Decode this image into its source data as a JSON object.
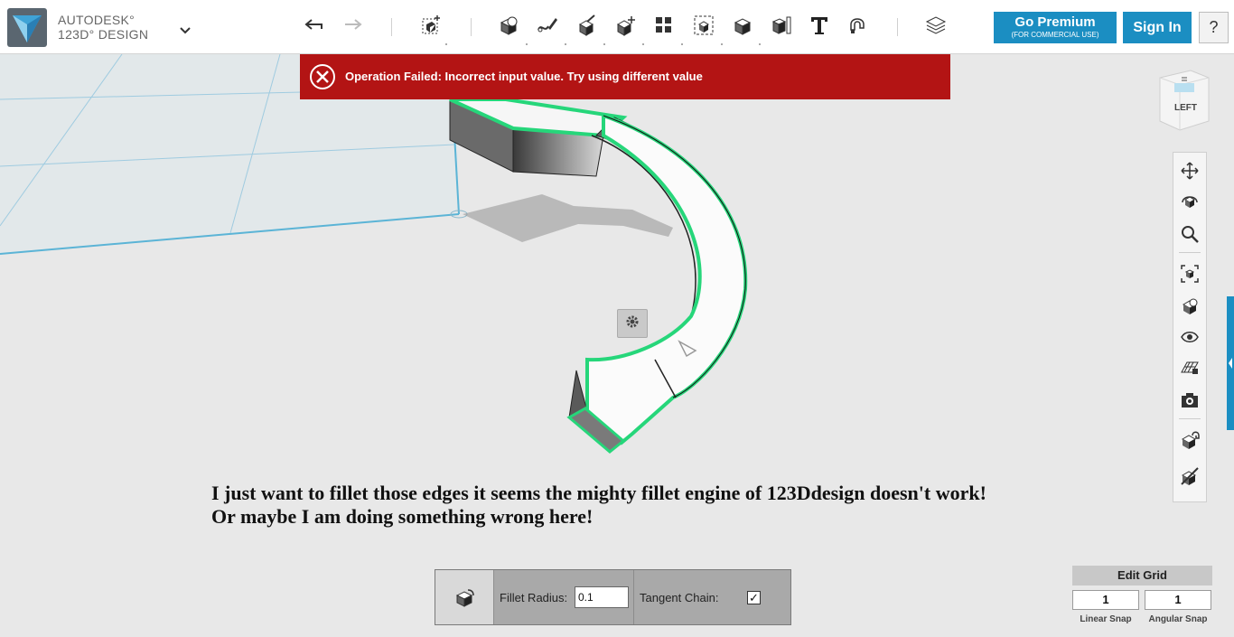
{
  "app": {
    "brand_line1": "AUTODESK°",
    "brand_line2": "123D° DESIGN",
    "accent_color": "#1b8ec2",
    "error_color": "#b31414"
  },
  "toolbar": {
    "icons": [
      "undo-icon",
      "redo-icon",
      "transform-icon",
      "primitives-icon",
      "sketch-icon",
      "construct-icon",
      "modify-icon",
      "pattern-icon",
      "grouping-icon",
      "combine-icon",
      "measure-icon",
      "text-icon",
      "snap-icon",
      "materials-icon"
    ],
    "premium_label": "Go Premium",
    "premium_sub": "(FOR COMMERCIAL USE)",
    "signin_label": "Sign In",
    "help_label": "?"
  },
  "error": {
    "message": "Operation Failed: Incorrect input value. Try using different value"
  },
  "viewcube": {
    "face_label": "LEFT"
  },
  "navbar": {
    "icons": [
      "pan-icon",
      "orbit-icon",
      "zoom-icon",
      "fit-icon",
      "view-mode-icon",
      "visibility-icon",
      "grid-icon",
      "camera-icon",
      "snap-tool-icon",
      "hide-icon"
    ]
  },
  "note": {
    "line1": "I just want to fillet those edges it seems the mighty fillet engine of 123Ddesign doesn't work!",
    "line2": "Or maybe I am doing something wrong here!"
  },
  "fillet": {
    "radius_label": "Fillet Radius:",
    "radius_value": "0.1",
    "tangent_label": "Tangent Chain:",
    "tangent_checked": true,
    "check_glyph": "✓"
  },
  "grid": {
    "title": "Edit Grid",
    "linear_value": "1",
    "angular_value": "1",
    "linear_label": "Linear Snap",
    "angular_label": "Angular Snap"
  }
}
